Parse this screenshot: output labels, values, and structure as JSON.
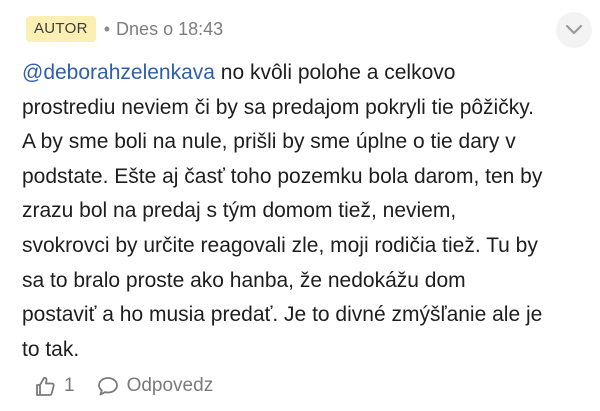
{
  "comment": {
    "badge": "AUTOR",
    "separator": "•",
    "timestamp": "Dnes o 18:43",
    "mention": "@deborahzelenkava",
    "text": " no kvôli polohe a celkovo\nprostrediu neviem či by sa predajom pokryli tie pôžičky.\nA by sme boli na nule, prišli by sme úplne o tie dary v\npodstate. Ešte aj časť toho pozemku bola darom, ten by\nzrazu bol na predaj s tým domom tiež, neviem,\nsvokrovci by určite reagovali zle, moji rodičia tiež. Tu by\nsa to bralo proste ako hanba, že nedokážu dom\npostaviť a ho musia predať. Je to divné zmýšľanie ale je\nto tak.",
    "like_count": "1",
    "reply_label": "Odpovedz",
    "icons": {
      "menu": "chevron-down-icon",
      "like": "thumbs-up-icon",
      "reply": "speech-bubble-icon"
    },
    "colors": {
      "badge_bg": "#fbefb4",
      "mention": "#2f5fa8",
      "muted": "#7a7a7a"
    }
  }
}
